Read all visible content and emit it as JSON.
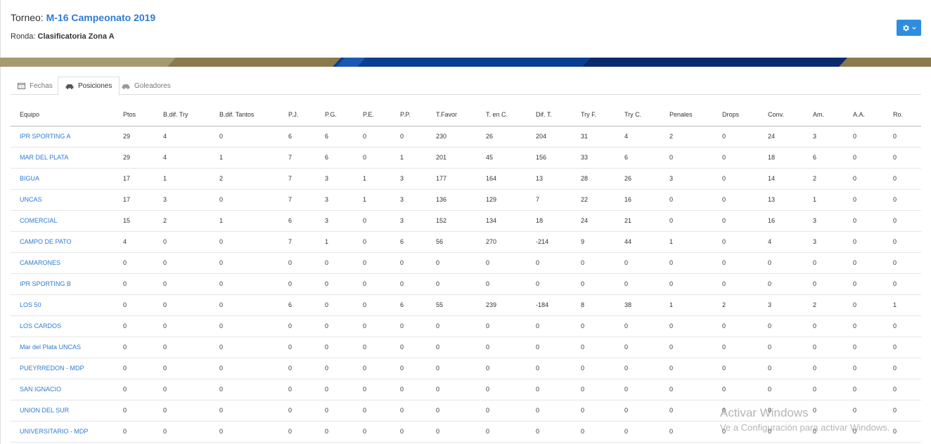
{
  "header": {
    "tournament_label": "Torneo: ",
    "tournament_name": "M-16 Campeonato 2019",
    "round_label": "Ronda: ",
    "round_name": "Clasificatoria Zona A"
  },
  "colors": {
    "accent": "#2e7bd6",
    "button": "#2e8de0",
    "banner_gold": "#8a7a4c",
    "banner_blue": "#0a3f8f",
    "banner_navy": "#0a2a6e"
  },
  "tabs": [
    {
      "label": "Fechas",
      "icon": "calendar-icon",
      "active": false
    },
    {
      "label": "Posiciones",
      "icon": "car-icon",
      "active": true
    },
    {
      "label": "Goleadores",
      "icon": "car-icon",
      "active": false
    }
  ],
  "table": {
    "columns": [
      "Equipo",
      "Ptos",
      "B.dif. Try",
      "B.dif. Tantos",
      "P.J.",
      "P.G.",
      "P.E.",
      "P.P.",
      "T.Favor",
      "T. en C.",
      "Dif. T.",
      "Try F.",
      "Try C.",
      "Penales",
      "Drops",
      "Conv.",
      "Am.",
      "A.A.",
      "Ro."
    ],
    "rows": [
      [
        "IPR SPORTING A",
        "29",
        "4",
        "0",
        "6",
        "6",
        "0",
        "0",
        "230",
        "26",
        "204",
        "31",
        "4",
        "2",
        "0",
        "24",
        "3",
        "0",
        "0"
      ],
      [
        "MAR DEL PLATA",
        "29",
        "4",
        "1",
        "7",
        "6",
        "0",
        "1",
        "201",
        "45",
        "156",
        "33",
        "6",
        "0",
        "0",
        "18",
        "6",
        "0",
        "0"
      ],
      [
        "BIGUA",
        "17",
        "1",
        "2",
        "7",
        "3",
        "1",
        "3",
        "177",
        "164",
        "13",
        "28",
        "26",
        "3",
        "0",
        "14",
        "2",
        "0",
        "0"
      ],
      [
        "UNCAS",
        "17",
        "3",
        "0",
        "7",
        "3",
        "1",
        "3",
        "136",
        "129",
        "7",
        "22",
        "16",
        "0",
        "0",
        "13",
        "1",
        "0",
        "0"
      ],
      [
        "COMERCIAL",
        "15",
        "2",
        "1",
        "6",
        "3",
        "0",
        "3",
        "152",
        "134",
        "18",
        "24",
        "21",
        "0",
        "0",
        "16",
        "3",
        "0",
        "0"
      ],
      [
        "CAMPO DE PATO",
        "4",
        "0",
        "0",
        "7",
        "1",
        "0",
        "6",
        "56",
        "270",
        "-214",
        "9",
        "44",
        "1",
        "0",
        "4",
        "3",
        "0",
        "0"
      ],
      [
        "CAMARONES",
        "0",
        "0",
        "0",
        "0",
        "0",
        "0",
        "0",
        "0",
        "0",
        "0",
        "0",
        "0",
        "0",
        "0",
        "0",
        "0",
        "0",
        "0"
      ],
      [
        "IPR SPORTING B",
        "0",
        "0",
        "0",
        "0",
        "0",
        "0",
        "0",
        "0",
        "0",
        "0",
        "0",
        "0",
        "0",
        "0",
        "0",
        "0",
        "0",
        "0"
      ],
      [
        "LOS 50",
        "0",
        "0",
        "0",
        "6",
        "0",
        "0",
        "6",
        "55",
        "239",
        "-184",
        "8",
        "38",
        "1",
        "2",
        "3",
        "2",
        "0",
        "1"
      ],
      [
        "LOS CARDOS",
        "0",
        "0",
        "0",
        "0",
        "0",
        "0",
        "0",
        "0",
        "0",
        "0",
        "0",
        "0",
        "0",
        "0",
        "0",
        "0",
        "0",
        "0"
      ],
      [
        "Mar del Plata UNCAS",
        "0",
        "0",
        "0",
        "0",
        "0",
        "0",
        "0",
        "0",
        "0",
        "0",
        "0",
        "0",
        "0",
        "0",
        "0",
        "0",
        "0",
        "0"
      ],
      [
        "PUEYRREDON - MDP",
        "0",
        "0",
        "0",
        "0",
        "0",
        "0",
        "0",
        "0",
        "0",
        "0",
        "0",
        "0",
        "0",
        "0",
        "0",
        "0",
        "0",
        "0"
      ],
      [
        "SAN IGNACIO",
        "0",
        "0",
        "0",
        "0",
        "0",
        "0",
        "0",
        "0",
        "0",
        "0",
        "0",
        "0",
        "0",
        "0",
        "0",
        "0",
        "0",
        "0"
      ],
      [
        "UNION DEL SUR",
        "0",
        "0",
        "0",
        "0",
        "0",
        "0",
        "0",
        "0",
        "0",
        "0",
        "0",
        "0",
        "0",
        "0",
        "0",
        "0",
        "0",
        "0"
      ],
      [
        "UNIVERSITARIO - MDP",
        "0",
        "0",
        "0",
        "0",
        "0",
        "0",
        "0",
        "0",
        "0",
        "0",
        "0",
        "0",
        "0",
        "0",
        "0",
        "0",
        "0",
        "0"
      ]
    ]
  },
  "watermark": {
    "line1": "Activar Windows",
    "line2": "Ve a Configuración para activar Windows."
  }
}
